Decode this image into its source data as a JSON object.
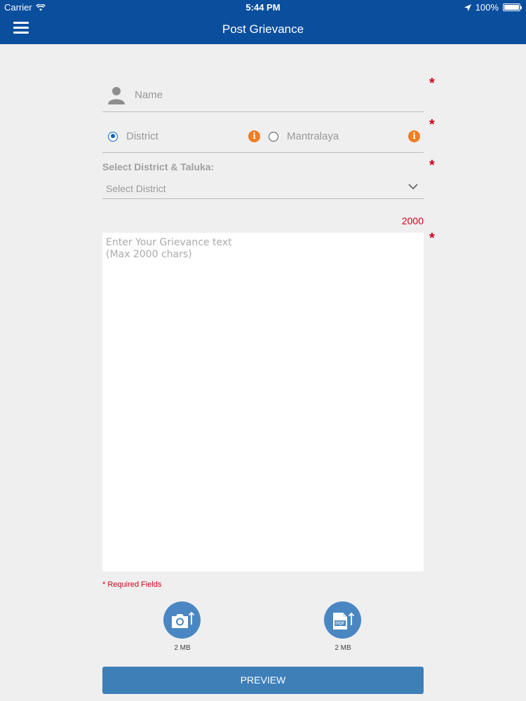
{
  "status_bar": {
    "carrier": "Carrier",
    "time": "5:44 PM",
    "battery": "100%"
  },
  "nav": {
    "title": "Post Grievance"
  },
  "form": {
    "name_placeholder": "Name",
    "radio_options": [
      {
        "label": "District",
        "selected": true
      },
      {
        "label": "Mantralaya",
        "selected": false
      }
    ],
    "info_glyph": "i",
    "select_label": "Select District & Taluka:",
    "select_value": "Select District",
    "char_count": "2000",
    "grievance_placeholder": "Enter Your Grievance text\n(Max 2000 chars)",
    "required_marker": "*",
    "required_note": "* Required Fields"
  },
  "uploads": [
    {
      "icon": "camera-upload-icon",
      "size": "2 MB"
    },
    {
      "icon": "pdf-upload-icon",
      "size": "2 MB"
    }
  ],
  "preview_label": "PREVIEW",
  "colors": {
    "header": "#0a4e9e",
    "required": "#d0021b",
    "info": "#f47c20",
    "upload": "#4a87c2",
    "button": "#3e7fb8"
  }
}
